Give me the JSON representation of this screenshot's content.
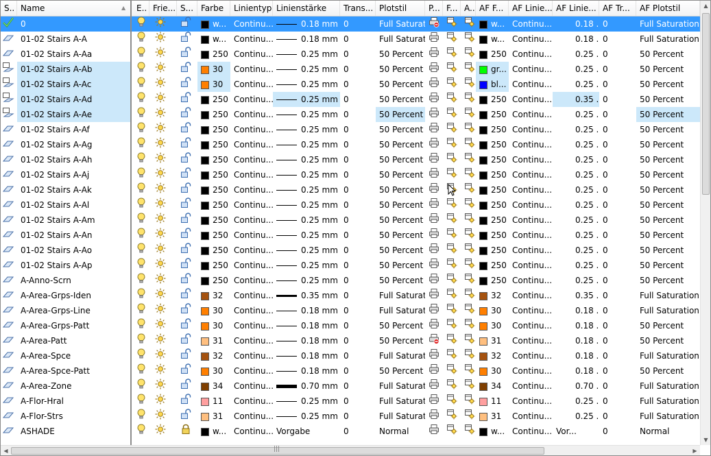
{
  "columns": [
    {
      "id": "status",
      "label": "S.."
    },
    {
      "id": "name",
      "label": "Name"
    },
    {
      "id": "on",
      "label": "E.."
    },
    {
      "id": "freeze",
      "label": "Frie..."
    },
    {
      "id": "lock",
      "label": "S..."
    },
    {
      "id": "color",
      "label": "Farbe"
    },
    {
      "id": "linetype",
      "label": "Linientyp"
    },
    {
      "id": "lineweight",
      "label": "Linienstärke"
    },
    {
      "id": "transparency",
      "label": "Trans..."
    },
    {
      "id": "plotstyle",
      "label": "Plotstil"
    },
    {
      "id": "plot",
      "label": "P..."
    },
    {
      "id": "vpfreeze",
      "label": "F..."
    },
    {
      "id": "newvpfreeze",
      "label": "A..."
    },
    {
      "id": "vpcolor",
      "label": "AF F..."
    },
    {
      "id": "vplinetype",
      "label": "AF Linie..."
    },
    {
      "id": "vplineweight",
      "label": "AF Linie..."
    },
    {
      "id": "vptransparency",
      "label": "AF Tr..."
    },
    {
      "id": "vpplotstyle",
      "label": "AF Plotstil"
    }
  ],
  "scroll": {
    "horizontal_grip": "|||"
  },
  "colors": {
    "selection": "#cce8fa",
    "current": "#3399ff",
    "black": "#000000",
    "orange30": "#ff7f00",
    "brown32": "#a5520f",
    "peach31": "#ffbf7f",
    "pink11": "#ff9f9f",
    "brown34": "#7f3f00",
    "green": "#00ff00",
    "blue": "#0000ff"
  },
  "rows": [
    {
      "name": "0",
      "cur": true,
      "status": "check",
      "lock": "open",
      "color": "black",
      "colorLabel": "w...",
      "linetype": "Continu...",
      "lwType": "thin",
      "lw": "0.18 mm",
      "tr": "0",
      "plot": "Full Saturation",
      "plotIcon": "noplot",
      "vpc": "black",
      "vpcLabel": "w...",
      "vplt": "Continu...",
      "vplwType": "thin",
      "vplw": "0.18 ...",
      "vptr": "0",
      "vpplot": "Full Saturation"
    },
    {
      "name": "01-02 Stairs A-A",
      "status": "layer",
      "lock": "open",
      "color": "black",
      "colorLabel": "w...",
      "linetype": "Continu...",
      "lwType": "thin",
      "lw": "0.18 mm",
      "tr": "0",
      "plot": "Full Saturation",
      "plotIcon": "printer",
      "vpc": "black",
      "vpcLabel": "w...",
      "vplt": "Continu...",
      "vplwType": "thin",
      "vplw": "0.18 ...",
      "vptr": "0",
      "vpplot": "Full Saturation"
    },
    {
      "name": "01-02 Stairs A-Aa",
      "status": "layer",
      "lock": "open",
      "color": "black",
      "colorLabel": "250",
      "linetype": "Continu...",
      "lwType": "thin",
      "lw": "0.25 mm",
      "tr": "0",
      "plot": "50 Percent",
      "plotIcon": "printer",
      "vpc": "black",
      "vpcLabel": "250",
      "vplt": "Continu...",
      "vplwType": "thin",
      "vplw": "0.25 ...",
      "vptr": "0",
      "vpplot": "50 Percent"
    },
    {
      "name": "01-02 Stairs A-Ab",
      "status": "override",
      "selName": true,
      "lock": "open",
      "color": "orange30",
      "colorLabel": "30",
      "selColor": true,
      "linetype": "Continu...",
      "lwType": "thin",
      "lw": "0.25 mm",
      "tr": "0",
      "plot": "50 Percent",
      "plotIcon": "printer",
      "vpc": "green",
      "vpcLabel": "gr...",
      "selVpc": true,
      "vplt": "Continu...",
      "vplwType": "thin",
      "vplw": "0.25 ...",
      "vptr": "0",
      "vpplot": "50 Percent"
    },
    {
      "name": "01-02 Stairs A-Ac",
      "status": "override",
      "selName": true,
      "lock": "open",
      "color": "orange30",
      "colorLabel": "30",
      "selColor": true,
      "linetype": "Continu...",
      "lwType": "thin",
      "lw": "0.25 mm",
      "tr": "0",
      "plot": "50 Percent",
      "plotIcon": "printer",
      "vpc": "blue",
      "vpcLabel": "bl...",
      "selVpc": true,
      "vplt": "Continu...",
      "vplwType": "thin",
      "vplw": "0.25 ...",
      "vptr": "0",
      "vpplot": "50 Percent"
    },
    {
      "name": "01-02 Stairs A-Ad",
      "status": "override",
      "selName": true,
      "lock": "open",
      "color": "black",
      "colorLabel": "250",
      "linetype": "Continu...",
      "lwType": "thin",
      "lw": "0.25 mm",
      "selLw": true,
      "tr": "0",
      "plot": "50 Percent",
      "plotIcon": "printer",
      "vpc": "black",
      "vpcLabel": "250",
      "vplt": "Continu...",
      "vplwType": "thick",
      "vplw": "0.35 ...",
      "selVplw": true,
      "vptr": "0",
      "vpplot": "50 Percent"
    },
    {
      "name": "01-02 Stairs A-Ae",
      "status": "override",
      "selName": true,
      "lock": "open",
      "color": "black",
      "colorLabel": "250",
      "linetype": "Continu...",
      "lwType": "thin",
      "lw": "0.25 mm",
      "tr": "0",
      "plot": "50 Percent",
      "selPlot": true,
      "plotIcon": "printer",
      "vpc": "black",
      "vpcLabel": "250",
      "vplt": "Continu...",
      "vplwType": "thin",
      "vplw": "0.25 ...",
      "vptr": "0",
      "vpplot": "50 Percent",
      "selVpplot": true
    },
    {
      "name": "01-02 Stairs A-Af",
      "status": "layer",
      "lock": "open",
      "color": "black",
      "colorLabel": "250",
      "linetype": "Continu...",
      "lwType": "thin",
      "lw": "0.25 mm",
      "tr": "0",
      "plot": "50 Percent",
      "plotIcon": "printer",
      "vpc": "black",
      "vpcLabel": "250",
      "vplt": "Continu...",
      "vplwType": "thin",
      "vplw": "0.25 ...",
      "vptr": "0",
      "vpplot": "50 Percent"
    },
    {
      "name": "01-02 Stairs A-Ag",
      "status": "layer",
      "lock": "open",
      "color": "black",
      "colorLabel": "250",
      "linetype": "Continu...",
      "lwType": "thin",
      "lw": "0.25 mm",
      "tr": "0",
      "plot": "50 Percent",
      "plotIcon": "printer",
      "vpc": "black",
      "vpcLabel": "250",
      "vplt": "Continu...",
      "vplwType": "thin",
      "vplw": "0.25 ...",
      "vptr": "0",
      "vpplot": "50 Percent"
    },
    {
      "name": "01-02 Stairs A-Ah",
      "status": "layer",
      "lock": "open",
      "color": "black",
      "colorLabel": "250",
      "linetype": "Continu...",
      "lwType": "thin",
      "lw": "0.25 mm",
      "tr": "0",
      "plot": "50 Percent",
      "plotIcon": "printer",
      "vpc": "black",
      "vpcLabel": "250",
      "vplt": "Continu...",
      "vplwType": "thin",
      "vplw": "0.25 ...",
      "vptr": "0",
      "vpplot": "50 Percent"
    },
    {
      "name": "01-02 Stairs A-Aj",
      "status": "layer",
      "lock": "open",
      "color": "black",
      "colorLabel": "250",
      "linetype": "Continu...",
      "lwType": "thin",
      "lw": "0.25 mm",
      "tr": "0",
      "plot": "50 Percent",
      "plotIcon": "printer",
      "vpc": "black",
      "vpcLabel": "250",
      "vplt": "Continu...",
      "vplwType": "thin",
      "vplw": "0.25 ...",
      "vptr": "0",
      "vpplot": "50 Percent"
    },
    {
      "name": "01-02 Stairs A-Ak",
      "status": "layer",
      "lock": "open",
      "color": "black",
      "colorLabel": "250",
      "linetype": "Continu...",
      "lwType": "thin",
      "lw": "0.25 mm",
      "tr": "0",
      "plot": "50 Percent",
      "plotIcon": "printer",
      "cursor": true,
      "vpc": "black",
      "vpcLabel": "250",
      "vplt": "Continu...",
      "vplwType": "thin",
      "vplw": "0.25 ...",
      "vptr": "0",
      "vpplot": "50 Percent"
    },
    {
      "name": "01-02 Stairs A-Al",
      "status": "layer",
      "lock": "open",
      "color": "black",
      "colorLabel": "250",
      "linetype": "Continu...",
      "lwType": "thin",
      "lw": "0.25 mm",
      "tr": "0",
      "plot": "50 Percent",
      "plotIcon": "printer",
      "vpc": "black",
      "vpcLabel": "250",
      "vplt": "Continu...",
      "vplwType": "thin",
      "vplw": "0.25 ...",
      "vptr": "0",
      "vpplot": "50 Percent"
    },
    {
      "name": "01-02 Stairs A-Am",
      "status": "layer",
      "lock": "open",
      "color": "black",
      "colorLabel": "250",
      "linetype": "Continu...",
      "lwType": "thin",
      "lw": "0.25 mm",
      "tr": "0",
      "plot": "50 Percent",
      "plotIcon": "printer",
      "vpc": "black",
      "vpcLabel": "250",
      "vplt": "Continu...",
      "vplwType": "thin",
      "vplw": "0.25 ...",
      "vptr": "0",
      "vpplot": "50 Percent"
    },
    {
      "name": "01-02 Stairs A-An",
      "status": "layer",
      "lock": "open",
      "color": "black",
      "colorLabel": "250",
      "linetype": "Continu...",
      "lwType": "thin",
      "lw": "0.25 mm",
      "tr": "0",
      "plot": "50 Percent",
      "plotIcon": "printer",
      "vpc": "black",
      "vpcLabel": "250",
      "vplt": "Continu...",
      "vplwType": "thin",
      "vplw": "0.25 ...",
      "vptr": "0",
      "vpplot": "50 Percent"
    },
    {
      "name": "01-02 Stairs A-Ao",
      "status": "layer",
      "lock": "open",
      "color": "black",
      "colorLabel": "250",
      "linetype": "Continu...",
      "lwType": "thin",
      "lw": "0.25 mm",
      "tr": "0",
      "plot": "50 Percent",
      "plotIcon": "printer",
      "vpc": "black",
      "vpcLabel": "250",
      "vplt": "Continu...",
      "vplwType": "thin",
      "vplw": "0.25 ...",
      "vptr": "0",
      "vpplot": "50 Percent"
    },
    {
      "name": "01-02 Stairs A-Ap",
      "status": "layer",
      "lock": "open",
      "color": "black",
      "colorLabel": "250",
      "linetype": "Continu...",
      "lwType": "thin",
      "lw": "0.25 mm",
      "tr": "0",
      "plot": "50 Percent",
      "plotIcon": "printer",
      "vpc": "black",
      "vpcLabel": "250",
      "vplt": "Continu...",
      "vplwType": "thin",
      "vplw": "0.25 ...",
      "vptr": "0",
      "vpplot": "50 Percent"
    },
    {
      "name": "A-Anno-Scrn",
      "status": "layer",
      "lock": "open",
      "color": "black",
      "colorLabel": "250",
      "linetype": "Continu...",
      "lwType": "thin",
      "lw": "0.25 mm",
      "tr": "0",
      "plot": "50 Percent",
      "plotIcon": "printer",
      "vpc": "black",
      "vpcLabel": "250",
      "vplt": "Continu...",
      "vplwType": "thin",
      "vplw": "0.25 ...",
      "vptr": "0",
      "vpplot": "50 Percent"
    },
    {
      "name": "A-Area-Grps-Iden",
      "status": "layer",
      "lock": "open",
      "color": "brown32",
      "colorLabel": "32",
      "linetype": "Continu...",
      "lwType": "thick",
      "lw": "0.35 mm",
      "tr": "0",
      "plot": "Full Saturation",
      "plotIcon": "printer",
      "vpc": "brown32",
      "vpcLabel": "32",
      "vplt": "Continu...",
      "vplwType": "thick",
      "vplw": "0.35 ...",
      "vptr": "0",
      "vpplot": "Full Saturation"
    },
    {
      "name": "A-Area-Grps-Line",
      "status": "layer",
      "lock": "open",
      "color": "orange30",
      "colorLabel": "30",
      "linetype": "Continu...",
      "lwType": "thin",
      "lw": "0.18 mm",
      "tr": "0",
      "plot": "Full Saturation",
      "plotIcon": "printer",
      "vpc": "orange30",
      "vpcLabel": "30",
      "vplt": "Continu...",
      "vplwType": "thin",
      "vplw": "0.18 ...",
      "vptr": "0",
      "vpplot": "Full Saturation"
    },
    {
      "name": "A-Area-Grps-Patt",
      "status": "layer",
      "lock": "open",
      "color": "orange30",
      "colorLabel": "30",
      "linetype": "Continu...",
      "lwType": "thin",
      "lw": "0.18 mm",
      "tr": "0",
      "plot": "50 Percent",
      "plotIcon": "printer",
      "vpc": "orange30",
      "vpcLabel": "30",
      "vplt": "Continu...",
      "vplwType": "thin",
      "vplw": "0.18 ...",
      "vptr": "0",
      "vpplot": "50 Percent"
    },
    {
      "name": "A-Area-Patt",
      "status": "layer",
      "lock": "open",
      "color": "peach31",
      "colorLabel": "31",
      "linetype": "Continu...",
      "lwType": "thin",
      "lw": "0.18 mm",
      "tr": "0",
      "plot": "50 Percent",
      "plotIcon": "noplot",
      "vpc": "peach31",
      "vpcLabel": "31",
      "vplt": "Continu...",
      "vplwType": "thin",
      "vplw": "0.18 ...",
      "vptr": "0",
      "vpplot": "50 Percent"
    },
    {
      "name": "A-Area-Spce",
      "status": "layer",
      "lock": "open",
      "color": "brown32",
      "colorLabel": "32",
      "linetype": "Continu...",
      "lwType": "thin",
      "lw": "0.18 mm",
      "tr": "0",
      "plot": "Full Saturation",
      "plotIcon": "printer",
      "vpc": "brown32",
      "vpcLabel": "32",
      "vplt": "Continu...",
      "vplwType": "thin",
      "vplw": "0.18 ...",
      "vptr": "0",
      "vpplot": "Full Saturation"
    },
    {
      "name": "A-Area-Spce-Patt",
      "status": "layer",
      "lock": "open",
      "color": "orange30",
      "colorLabel": "30",
      "linetype": "Continu...",
      "lwType": "thin",
      "lw": "0.18 mm",
      "tr": "0",
      "plot": "50 Percent",
      "plotIcon": "printer",
      "vpc": "orange30",
      "vpcLabel": "30",
      "vplt": "Continu...",
      "vplwType": "thin",
      "vplw": "0.18 ...",
      "vptr": "0",
      "vpplot": "50 Percent"
    },
    {
      "name": "A-Area-Zone",
      "status": "layer",
      "lock": "open",
      "color": "brown34",
      "colorLabel": "34",
      "linetype": "Continu...",
      "lwType": "heavy",
      "lw": "0.70 mm",
      "tr": "0",
      "plot": "Full Saturation",
      "plotIcon": "printer",
      "vpc": "brown34",
      "vpcLabel": "34",
      "vplt": "Continu...",
      "vplwType": "heavy",
      "vplw": "0.70 ...",
      "vptr": "0",
      "vpplot": "Full Saturation"
    },
    {
      "name": "A-Flor-Hral",
      "status": "layer",
      "lock": "open",
      "color": "pink11",
      "colorLabel": "11",
      "linetype": "Continu...",
      "lwType": "thin",
      "lw": "0.25 mm",
      "tr": "0",
      "plot": "Full Saturation",
      "plotIcon": "printer",
      "vpc": "pink11",
      "vpcLabel": "11",
      "vplt": "Continu...",
      "vplwType": "thin",
      "vplw": "0.25 ...",
      "vptr": "0",
      "vpplot": "Full Saturation"
    },
    {
      "name": "A-Flor-Strs",
      "status": "layer",
      "lock": "open",
      "color": "peach31",
      "colorLabel": "31",
      "linetype": "Continu...",
      "lwType": "thin",
      "lw": "0.25 mm",
      "tr": "0",
      "plot": "Full Saturation",
      "plotIcon": "printer",
      "vpc": "peach31",
      "vpcLabel": "31",
      "vplt": "Continu...",
      "vplwType": "thin",
      "vplw": "0.25 ...",
      "vptr": "0",
      "vpplot": "Full Saturation"
    },
    {
      "name": "ASHADE",
      "status": "layer",
      "lock": "closed",
      "color": "black",
      "colorLabel": "w...",
      "linetype": "Continu...",
      "lwType": "none",
      "lw": "Vorgabe",
      "tr": "0",
      "plot": "Normal",
      "plotIcon": "printer",
      "vpc": "black",
      "vpcLabel": "w...",
      "vplt": "Continu...",
      "vplwType": "none",
      "vplw": "Vor...",
      "vptr": "0",
      "vpplot": "Normal"
    }
  ]
}
